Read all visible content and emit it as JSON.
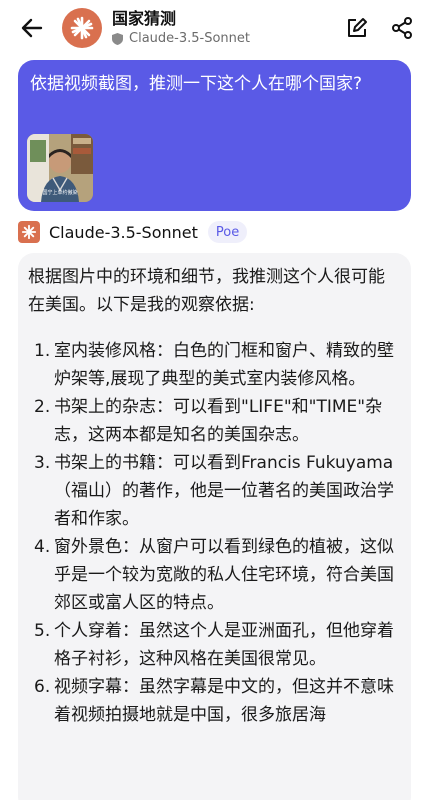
{
  "header": {
    "title": "国家猜测",
    "subtitle": "Claude-3.5-Sonnet",
    "icons": {
      "back": "back-arrow-icon",
      "edit": "edit-icon",
      "share": "share-icon"
    },
    "brand_color": "#d9704f"
  },
  "user_message": {
    "text": "依据视频截图，推测一下这个人在哪个国家?",
    "thumbnail_caption": "国宁上单约傲染",
    "bubble_color": "#5a5ae6"
  },
  "bot": {
    "name": "Claude-3.5-Sonnet",
    "badge": "Poe"
  },
  "answer": {
    "intro": "根据图片中的环境和细节，我推测这个人很可能在美国。以下是我的观察依据:",
    "points": [
      {
        "num": "1.",
        "text": "室内装修风格：白色的门框和窗户、精致的壁炉架等,展现了典型的美式室内装修风格。"
      },
      {
        "num": "2.",
        "text": "书架上的杂志：可以看到\"LIFE\"和\"TIME\"杂志，这两本都是知名的美国杂志。"
      },
      {
        "num": "3.",
        "text": "书架上的书籍：可以看到Francis Fukuyama（福山）的著作，他是一位著名的美国政治学者和作家。"
      },
      {
        "num": "4.",
        "text": "窗外景色：从窗户可以看到绿色的植被，这似乎是一个较为宽敞的私人住宅环境，符合美国郊区或富人区的特点。"
      },
      {
        "num": "5.",
        "text": "个人穿着：虽然这个人是亚洲面孔，但他穿着格子衬衫，这种风格在美国很常见。"
      },
      {
        "num": "6.",
        "text": "视频字幕：虽然字幕是中文的，但这并不意味着视频拍摄地就是中国，很多旅居海"
      }
    ]
  }
}
